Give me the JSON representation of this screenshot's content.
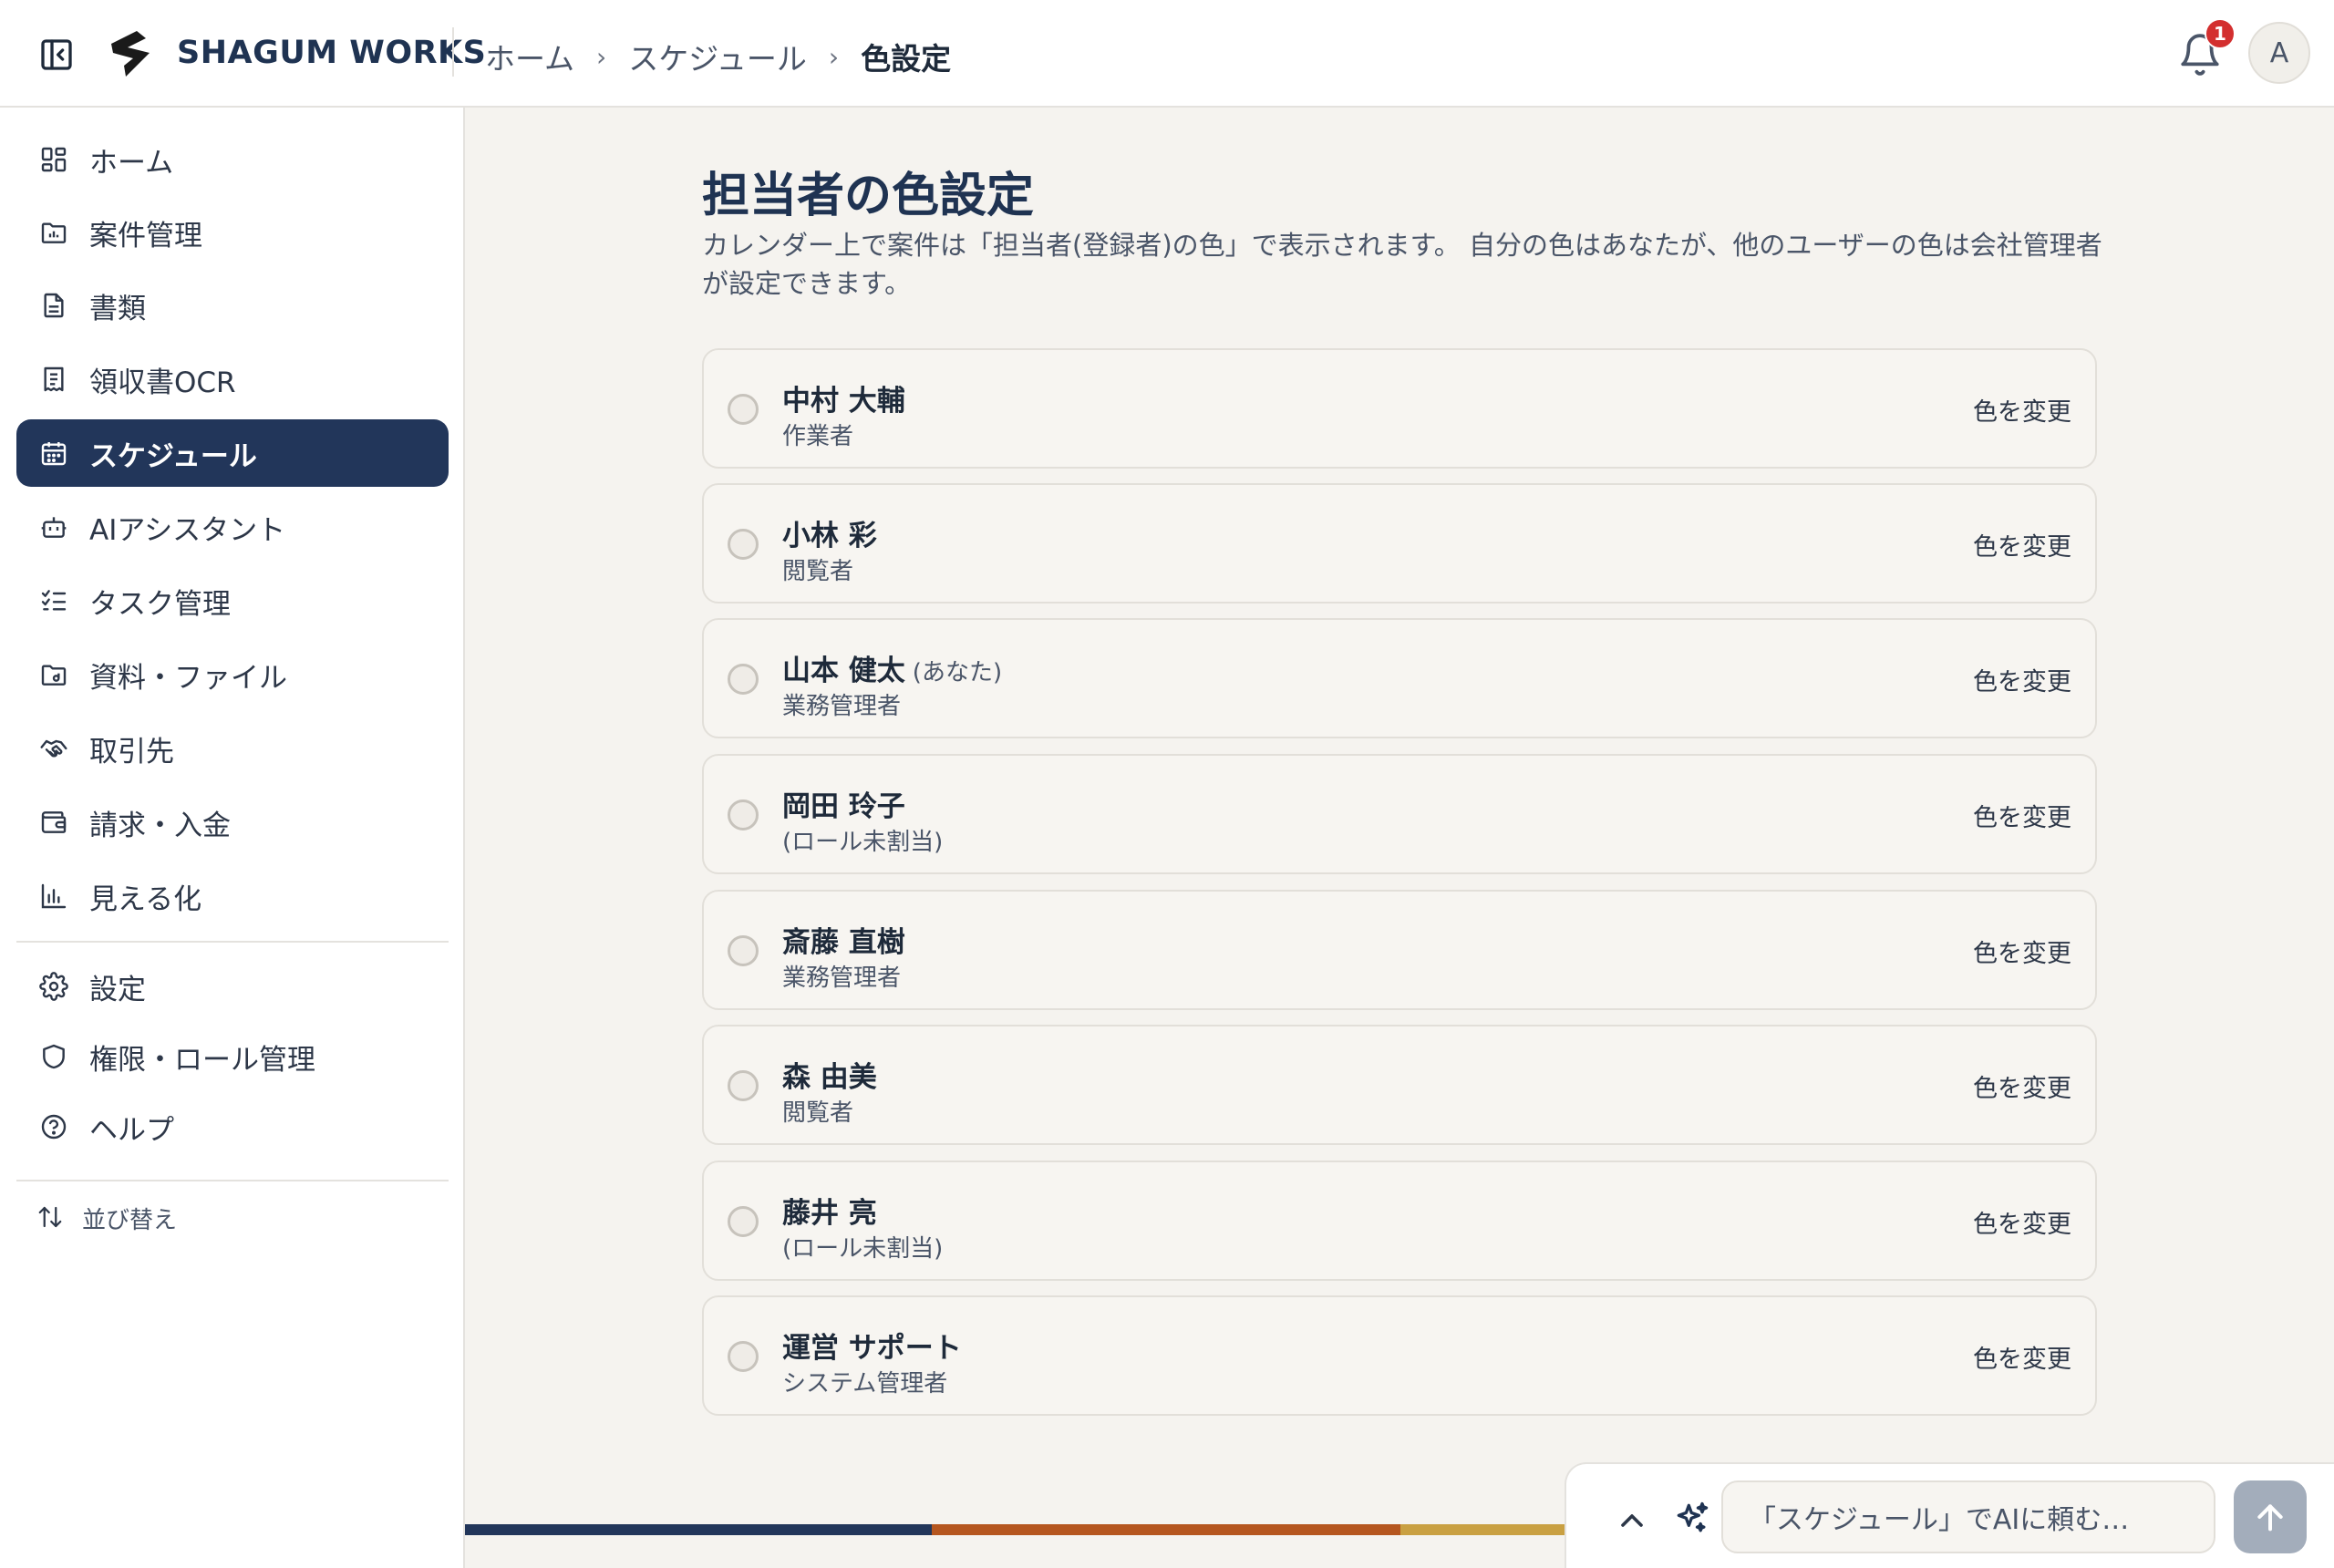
{
  "header": {
    "brand": "SHAGUM WORKS",
    "breadcrumb": [
      "ホーム",
      "スケジュール",
      "色設定"
    ],
    "notification_count": "1",
    "avatar_initial": "A"
  },
  "sidebar": {
    "items": [
      {
        "label": "ホーム",
        "icon": "grid-icon"
      },
      {
        "label": "案件管理",
        "icon": "folder-chart-icon"
      },
      {
        "label": "書類",
        "icon": "document-icon"
      },
      {
        "label": "領収書OCR",
        "icon": "receipt-icon"
      },
      {
        "label": "スケジュール",
        "icon": "calendar-icon",
        "active": true
      },
      {
        "label": "AIアシスタント",
        "icon": "bot-icon"
      },
      {
        "label": "タスク管理",
        "icon": "checklist-icon"
      },
      {
        "label": "資料・ファイル",
        "icon": "folder-file-icon"
      },
      {
        "label": "取引先",
        "icon": "handshake-icon"
      },
      {
        "label": "請求・入金",
        "icon": "wallet-icon"
      },
      {
        "label": "見える化",
        "icon": "bar-chart-icon"
      }
    ],
    "secondary": [
      {
        "label": "設定",
        "icon": "gear-icon"
      },
      {
        "label": "権限・ロール管理",
        "icon": "shield-icon"
      },
      {
        "label": "ヘルプ",
        "icon": "help-circle-icon"
      }
    ],
    "sort_label": "並び替え"
  },
  "main": {
    "title": "担当者の色設定",
    "description": "カレンダー上で案件は「担当者(登録者)の色」で表示されます。 自分の色はあなたが、他のユーザーの色は会社管理者が設定できます。",
    "change_label": "色を変更",
    "you_suffix": "(あなた)",
    "users": [
      {
        "name": "中村 大輔",
        "role": "作業者"
      },
      {
        "name": "小林 彩",
        "role": "閲覧者"
      },
      {
        "name": "山本 健太",
        "role": "業務管理者",
        "is_you": true
      },
      {
        "name": "岡田 玲子",
        "role": "(ロール未割当)"
      },
      {
        "name": "斎藤 直樹",
        "role": "業務管理者"
      },
      {
        "name": "森 由美",
        "role": "閲覧者"
      },
      {
        "name": "藤井 亮",
        "role": "(ロール未割当)"
      },
      {
        "name": "運営 サポート",
        "role": "システム管理者"
      }
    ]
  },
  "ai": {
    "placeholder": "「スケジュール」でAIに頼む…"
  },
  "colors": {
    "navy": "#22365a",
    "rust": "#b5561f",
    "gold": "#c9a042",
    "badge": "#d32f2f"
  }
}
